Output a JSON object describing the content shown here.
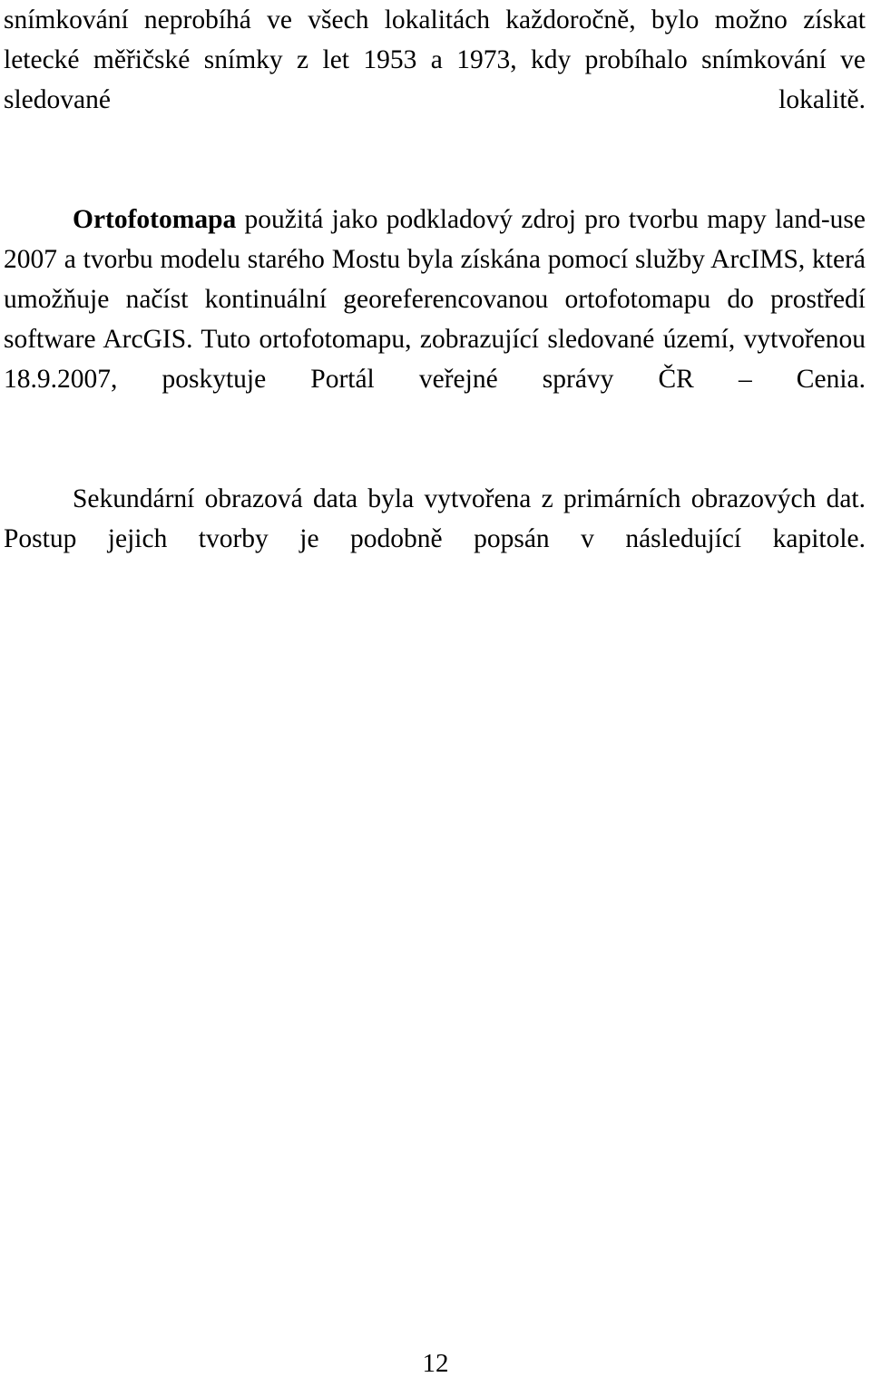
{
  "document": {
    "language": "cs",
    "page_number": "12",
    "body": {
      "paragraphs": [
        {
          "id": "paragraph-continued",
          "indent": false,
          "lead_bold": "",
          "text": "snímkování neprobíhá ve všech lokalitách každoročně, bylo možno získat letecké měřičské snímky z let 1953 a 1973, kdy probíhalo snímkování ve sledované lokalitě."
        },
        {
          "id": "paragraph-ortofotomapa",
          "indent": true,
          "lead_bold": "Ortofotomapa",
          "text": " použitá jako podkladový zdroj pro tvorbu mapy land-use 2007 a tvorbu modelu starého Mostu byla získána pomocí služby ArcIMS, která umožňuje načíst kontinuální georeferencovanou ortofotomapu do prostředí software ArcGIS. Tuto ortofotomapu, zobrazující sledované území, vytvořenou 18.9.2007, poskytuje Portál veřejné správy ČR – Cenia."
        },
        {
          "id": "paragraph-sekundarni",
          "indent": true,
          "lead_bold": "",
          "text": "Sekundární obrazová data byla vytvořena z primárních obrazových dat. Postup jejich tvorby je podobně popsán v následující kapitole."
        }
      ]
    }
  }
}
